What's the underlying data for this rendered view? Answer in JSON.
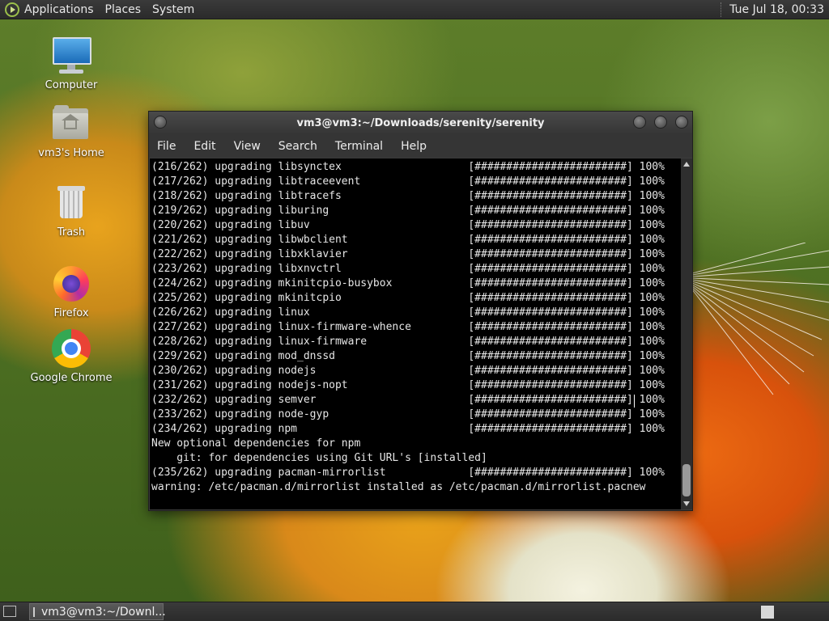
{
  "top_panel": {
    "menus": [
      "Applications",
      "Places",
      "System"
    ],
    "clock": "Tue Jul 18, 00:33"
  },
  "desktop_icons": [
    {
      "label": "Computer",
      "icon": "computer-icon"
    },
    {
      "label": "vm3's Home",
      "icon": "home-folder-icon"
    },
    {
      "label": "Trash",
      "icon": "trash-icon"
    },
    {
      "label": "Firefox",
      "icon": "firefox-icon"
    },
    {
      "label": "Google Chrome",
      "icon": "chrome-icon"
    }
  ],
  "window": {
    "title": "vm3@vm3:~/Downloads/serenity/serenity",
    "menu": [
      "File",
      "Edit",
      "View",
      "Search",
      "Terminal",
      "Help"
    ]
  },
  "terminal": {
    "lines": [
      "(216/262) upgrading libsynctex                    [########################] 100%",
      "(217/262) upgrading libtraceevent                 [########################] 100%",
      "(218/262) upgrading libtracefs                    [########################] 100%",
      "(219/262) upgrading liburing                      [########################] 100%",
      "(220/262) upgrading libuv                         [########################] 100%",
      "(221/262) upgrading libwbclient                   [########################] 100%",
      "(222/262) upgrading libxklavier                   [########################] 100%",
      "(223/262) upgrading libxnvctrl                    [########################] 100%",
      "(224/262) upgrading mkinitcpio-busybox            [########################] 100%",
      "(225/262) upgrading mkinitcpio                    [########################] 100%",
      "(226/262) upgrading linux                         [########################] 100%",
      "(227/262) upgrading linux-firmware-whence         [########################] 100%",
      "(228/262) upgrading linux-firmware                [########################] 100%",
      "(229/262) upgrading mod_dnssd                     [########################] 100%",
      "(230/262) upgrading nodejs                        [########################] 100%",
      "(231/262) upgrading nodejs-nopt                   [########################] 100%",
      "(232/262) upgrading semver                        [########################] 100%",
      "(233/262) upgrading node-gyp                      [########################] 100%",
      "(234/262) upgrading npm                           [########################] 100%",
      "New optional dependencies for npm",
      "    git: for dependencies using Git URL's [installed]",
      "(235/262) upgrading pacman-mirrorlist             [########################] 100%",
      "warning: /etc/pacman.d/mirrorlist installed as /etc/pacman.d/mirrorlist.pacnew"
    ]
  },
  "taskbar": {
    "task_label": "vm3@vm3:~/Downl..."
  }
}
